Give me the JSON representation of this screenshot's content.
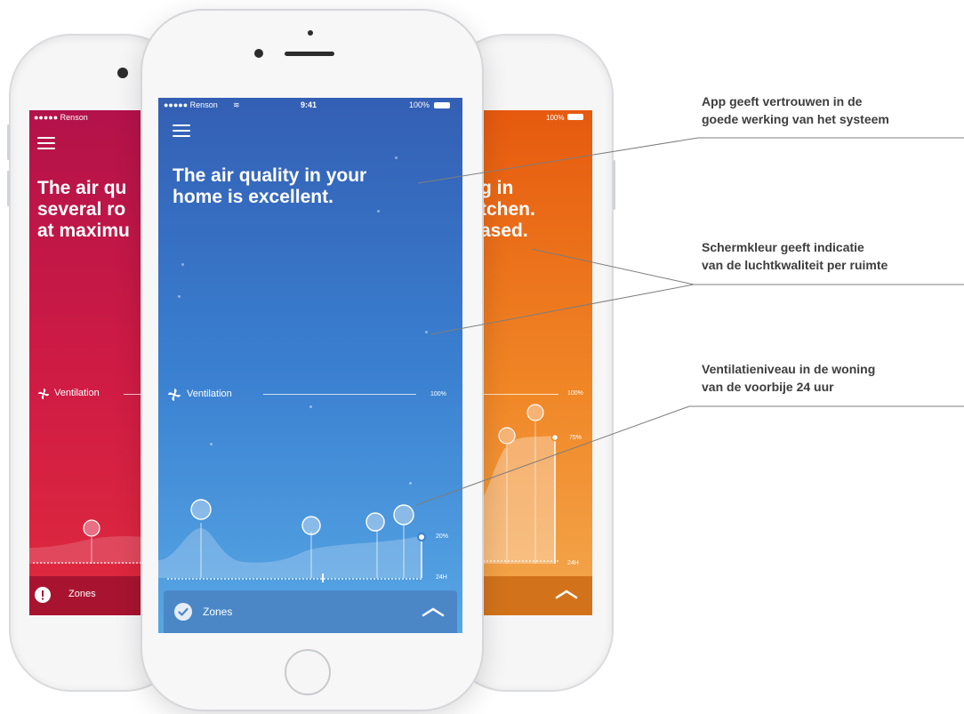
{
  "left_phone": {
    "carrier": "●●●●● Renson",
    "headline": "The air qu\nseveral ro\nat maximu",
    "ventilation_label": "Ventilation",
    "zones_label": "Zones",
    "colors": {
      "top": "#b3124a",
      "bottom": "#e02a3d"
    }
  },
  "center_phone": {
    "carrier": "●●●●● Renson",
    "time": "9:41",
    "battery": "100%",
    "headline": "The air quality in your\nhome is excellent.",
    "ventilation_label": "Ventilation",
    "max_label": "100%",
    "level_label": "20%",
    "range_label": "24H",
    "zones_label": "Zones",
    "colors": {
      "top": "#3a67b8",
      "bottom": "#5aa9e6"
    }
  },
  "right_phone": {
    "battery": "100%",
    "headline": "g in\ntchen.\nased.",
    "max_label": "100%",
    "level_label": "75%",
    "range_label": "24H",
    "colors": {
      "top": "#e86010",
      "bottom": "#f4a84e"
    }
  },
  "annotations": [
    {
      "text": "App geeft vertrouwen in de\ngoede werking van het systeem"
    },
    {
      "text": "Schermkleur geeft indicatie\nvan de luchtkwaliteit per ruimte"
    },
    {
      "text": "Ventilatieniveau in de woning\nvan de voorbije 24 uur"
    }
  ]
}
